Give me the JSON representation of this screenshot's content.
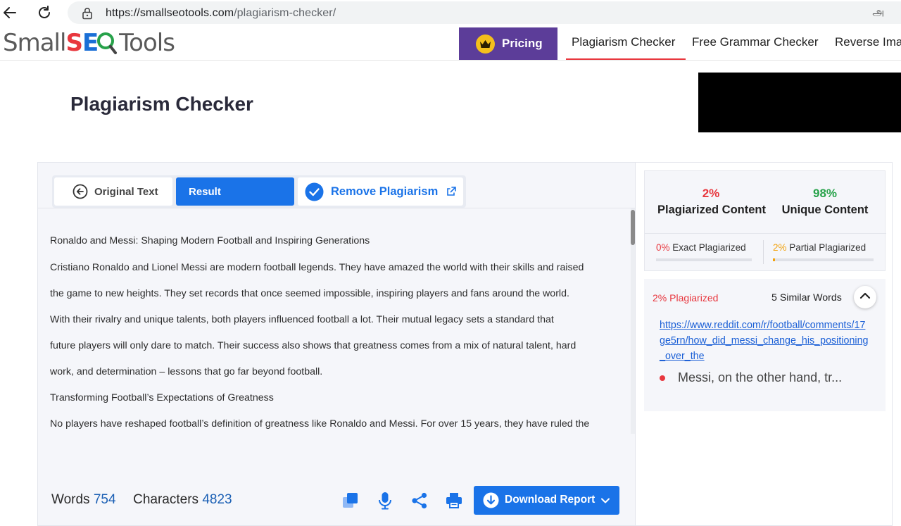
{
  "browser": {
    "url_host": "https://smallseotools.com",
    "url_path": "/plagiarism-checker/",
    "translate_glyph": "அ"
  },
  "header": {
    "logo_parts": {
      "a": "Small",
      "s": "S",
      "e": "E",
      "c": "Q",
      "b": "Tools"
    },
    "pricing_label": "Pricing",
    "nav": [
      "Plagiarism Checker",
      "Free Grammar Checker",
      "Reverse Ima"
    ]
  },
  "page": {
    "title": "Plagiarism Checker"
  },
  "tabs": {
    "original": "Original Text",
    "result": "Result",
    "remove": "Remove Plagiarism"
  },
  "document": {
    "lines": [
      "Ronaldo and Messi: Shaping Modern Football and Inspiring Generations",
      "Cristiano Ronaldo and Lionel Messi are modern football legends. They have amazed the world with their skills and raised",
      "the game to new heights. They set records that once seemed impossible, inspiring players and fans around the world.",
      "With their rivalry and unique talents, both players influenced football a lot. Their mutual legacy sets a standard that",
      "future players will only dare to match. Their success also shows that greatness comes from a mix of natural talent, hard",
      "work, and determination – lessons that go far beyond football.",
      "Transforming Football’s Expectations of Greatness",
      "No players have reshaped football’s definition of greatness like Ronaldo and Messi. For over 15 years, they have ruled the"
    ]
  },
  "counts": {
    "words_label": "Words",
    "words_value": "754",
    "chars_label": "Characters",
    "chars_value": "4823"
  },
  "toolbar": {
    "download_label": "Download Report"
  },
  "stats": {
    "plagiarized_pct": "2%",
    "plagiarized_label": "Plagiarized Content",
    "unique_pct": "98%",
    "unique_label": "Unique Content",
    "exact_pct": "0%",
    "exact_label": "Exact Plagiarized",
    "exact_fraction": 0.0,
    "partial_pct": "2%",
    "partial_label": "Partial Plagiarized",
    "partial_fraction": 0.02
  },
  "source": {
    "pct_label": "2% Plagiarized",
    "similar_label": "5 Similar Words",
    "url": "https://www.reddit.com/r/football/comments/17ge5rn/how_did_messi_change_his_positioning_over_the",
    "snippet": "Messi, on the other hand, tr..."
  },
  "colors": {
    "accent_blue": "#1a73e8",
    "pricing_purple": "#5c3d99",
    "plag_red": "#e8373e",
    "unique_green": "#27a24a",
    "partial_orange": "#f2a20d"
  }
}
